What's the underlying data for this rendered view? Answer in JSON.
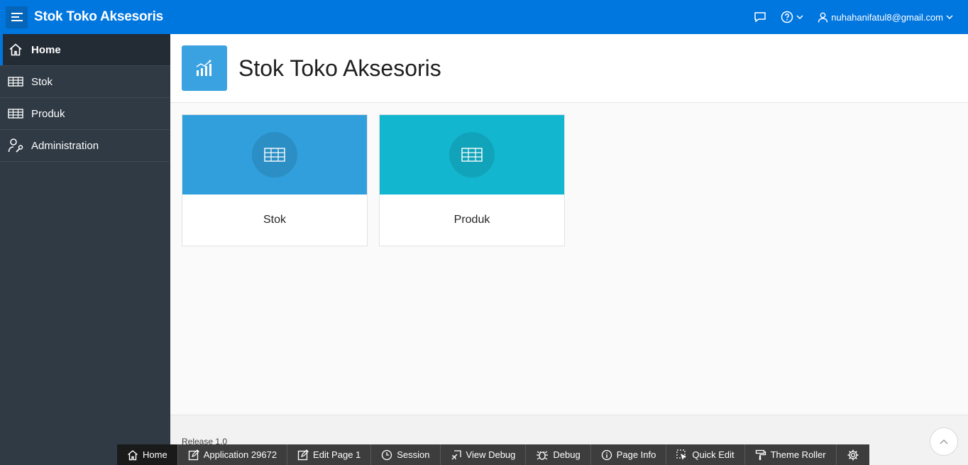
{
  "header": {
    "app_title": "Stok Toko Aksesoris",
    "user": "nuhahanifatul8@gmail.com",
    "icons": [
      "menu-icon",
      "feedback-icon",
      "help-icon",
      "user-icon"
    ]
  },
  "sidebar": {
    "items": [
      {
        "label": "Home",
        "icon": "home-icon",
        "active": true
      },
      {
        "label": "Stok",
        "icon": "table-icon"
      },
      {
        "label": "Produk",
        "icon": "table-icon"
      },
      {
        "label": "Administration",
        "icon": "user-wrench-icon"
      }
    ]
  },
  "hero": {
    "title": "Stok Toko Aksesoris",
    "icon": "chart-icon"
  },
  "cards": [
    {
      "label": "Stok",
      "color": "#309fdb",
      "icon": "table-icon"
    },
    {
      "label": "Produk",
      "color": "#13b6cf",
      "icon": "table-icon"
    }
  ],
  "footer": {
    "release": "Release 1.0"
  },
  "devbar": {
    "items": [
      "Home",
      "Application 29672",
      "Edit Page 1",
      "Session",
      "View Debug",
      "Debug",
      "Page Info",
      "Quick Edit",
      "Theme Roller"
    ]
  },
  "colors": {
    "header": "#0076df",
    "sidebar": "#2f3a45",
    "hero_icon": "#3aa2e0"
  }
}
